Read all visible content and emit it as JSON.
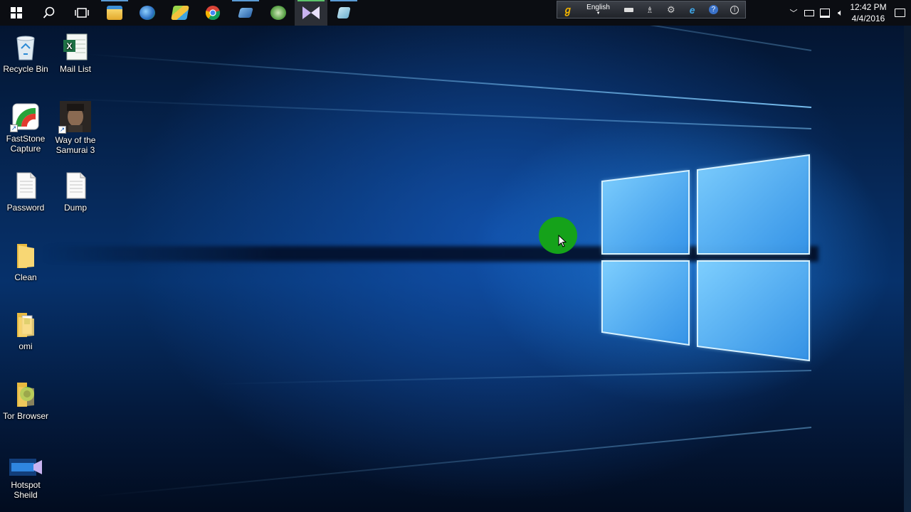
{
  "taskbar": {
    "apps": [
      {
        "icon": "start-windows-icon"
      },
      {
        "icon": "search-icon"
      },
      {
        "icon": "task-view-icon"
      },
      {
        "icon": "file-explorer-icon"
      },
      {
        "icon": "internet-download-manager-icon"
      },
      {
        "icon": "bluestacks-icon"
      },
      {
        "icon": "chrome-icon"
      },
      {
        "icon": "virtualbox-icon"
      },
      {
        "icon": "green-app-icon"
      },
      {
        "icon": "visual-studio-icon"
      },
      {
        "icon": "app-box-icon"
      }
    ]
  },
  "langbar": {
    "language": "English"
  },
  "clock": {
    "time": "12:42 PM",
    "date": "4/4/2016"
  },
  "desktop": {
    "icons": [
      {
        "label": "Recycle Bin",
        "icon": "recycle-bin-icon"
      },
      {
        "label": "Mail List",
        "icon": "excel-file-icon"
      },
      {
        "label": "FastStone Capture",
        "icon": "faststone-capture-icon"
      },
      {
        "label": "Way of the Samurai 3",
        "icon": "game-shortcut-icon"
      },
      {
        "label": "Password",
        "icon": "text-file-icon"
      },
      {
        "label": "Dump",
        "icon": "text-file-icon"
      },
      {
        "label": "Clean",
        "icon": "folder-icon"
      },
      {
        "label": "omi",
        "icon": "folder-icon"
      },
      {
        "label": "Tor Browser",
        "icon": "tor-browser-folder-icon"
      },
      {
        "label": "Hotspot Sheild",
        "icon": "hotspot-shield-icon"
      }
    ]
  },
  "colors": {
    "taskbar": "#0b0d12",
    "accent": "#5b9bd5",
    "cursor_highlight": "#15a21a"
  }
}
